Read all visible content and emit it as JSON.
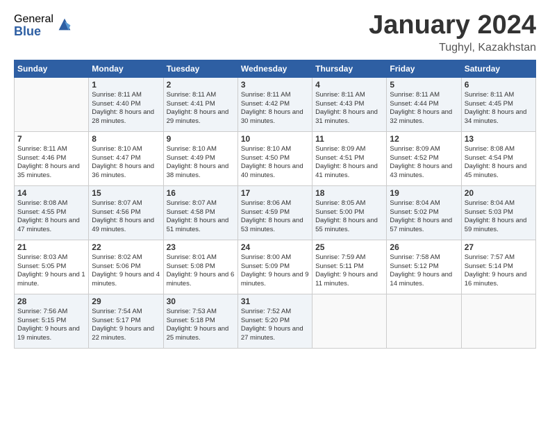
{
  "logo": {
    "general": "General",
    "blue": "Blue"
  },
  "title": "January 2024",
  "location": "Tughyl, Kazakhstan",
  "days_header": [
    "Sunday",
    "Monday",
    "Tuesday",
    "Wednesday",
    "Thursday",
    "Friday",
    "Saturday"
  ],
  "weeks": [
    [
      {
        "day": "",
        "sunrise": "",
        "sunset": "",
        "daylight": ""
      },
      {
        "day": "1",
        "sunrise": "8:11 AM",
        "sunset": "4:40 PM",
        "daylight": "8 hours and 28 minutes."
      },
      {
        "day": "2",
        "sunrise": "8:11 AM",
        "sunset": "4:41 PM",
        "daylight": "8 hours and 29 minutes."
      },
      {
        "day": "3",
        "sunrise": "8:11 AM",
        "sunset": "4:42 PM",
        "daylight": "8 hours and 30 minutes."
      },
      {
        "day": "4",
        "sunrise": "8:11 AM",
        "sunset": "4:43 PM",
        "daylight": "8 hours and 31 minutes."
      },
      {
        "day": "5",
        "sunrise": "8:11 AM",
        "sunset": "4:44 PM",
        "daylight": "8 hours and 32 minutes."
      },
      {
        "day": "6",
        "sunrise": "8:11 AM",
        "sunset": "4:45 PM",
        "daylight": "8 hours and 34 minutes."
      }
    ],
    [
      {
        "day": "7",
        "sunrise": "8:11 AM",
        "sunset": "4:46 PM",
        "daylight": "8 hours and 35 minutes."
      },
      {
        "day": "8",
        "sunrise": "8:10 AM",
        "sunset": "4:47 PM",
        "daylight": "8 hours and 36 minutes."
      },
      {
        "day": "9",
        "sunrise": "8:10 AM",
        "sunset": "4:49 PM",
        "daylight": "8 hours and 38 minutes."
      },
      {
        "day": "10",
        "sunrise": "8:10 AM",
        "sunset": "4:50 PM",
        "daylight": "8 hours and 40 minutes."
      },
      {
        "day": "11",
        "sunrise": "8:09 AM",
        "sunset": "4:51 PM",
        "daylight": "8 hours and 41 minutes."
      },
      {
        "day": "12",
        "sunrise": "8:09 AM",
        "sunset": "4:52 PM",
        "daylight": "8 hours and 43 minutes."
      },
      {
        "day": "13",
        "sunrise": "8:08 AM",
        "sunset": "4:54 PM",
        "daylight": "8 hours and 45 minutes."
      }
    ],
    [
      {
        "day": "14",
        "sunrise": "8:08 AM",
        "sunset": "4:55 PM",
        "daylight": "8 hours and 47 minutes."
      },
      {
        "day": "15",
        "sunrise": "8:07 AM",
        "sunset": "4:56 PM",
        "daylight": "8 hours and 49 minutes."
      },
      {
        "day": "16",
        "sunrise": "8:07 AM",
        "sunset": "4:58 PM",
        "daylight": "8 hours and 51 minutes."
      },
      {
        "day": "17",
        "sunrise": "8:06 AM",
        "sunset": "4:59 PM",
        "daylight": "8 hours and 53 minutes."
      },
      {
        "day": "18",
        "sunrise": "8:05 AM",
        "sunset": "5:00 PM",
        "daylight": "8 hours and 55 minutes."
      },
      {
        "day": "19",
        "sunrise": "8:04 AM",
        "sunset": "5:02 PM",
        "daylight": "8 hours and 57 minutes."
      },
      {
        "day": "20",
        "sunrise": "8:04 AM",
        "sunset": "5:03 PM",
        "daylight": "8 hours and 59 minutes."
      }
    ],
    [
      {
        "day": "21",
        "sunrise": "8:03 AM",
        "sunset": "5:05 PM",
        "daylight": "9 hours and 1 minute."
      },
      {
        "day": "22",
        "sunrise": "8:02 AM",
        "sunset": "5:06 PM",
        "daylight": "9 hours and 4 minutes."
      },
      {
        "day": "23",
        "sunrise": "8:01 AM",
        "sunset": "5:08 PM",
        "daylight": "9 hours and 6 minutes."
      },
      {
        "day": "24",
        "sunrise": "8:00 AM",
        "sunset": "5:09 PM",
        "daylight": "9 hours and 9 minutes."
      },
      {
        "day": "25",
        "sunrise": "7:59 AM",
        "sunset": "5:11 PM",
        "daylight": "9 hours and 11 minutes."
      },
      {
        "day": "26",
        "sunrise": "7:58 AM",
        "sunset": "5:12 PM",
        "daylight": "9 hours and 14 minutes."
      },
      {
        "day": "27",
        "sunrise": "7:57 AM",
        "sunset": "5:14 PM",
        "daylight": "9 hours and 16 minutes."
      }
    ],
    [
      {
        "day": "28",
        "sunrise": "7:56 AM",
        "sunset": "5:15 PM",
        "daylight": "9 hours and 19 minutes."
      },
      {
        "day": "29",
        "sunrise": "7:54 AM",
        "sunset": "5:17 PM",
        "daylight": "9 hours and 22 minutes."
      },
      {
        "day": "30",
        "sunrise": "7:53 AM",
        "sunset": "5:18 PM",
        "daylight": "9 hours and 25 minutes."
      },
      {
        "day": "31",
        "sunrise": "7:52 AM",
        "sunset": "5:20 PM",
        "daylight": "9 hours and 27 minutes."
      },
      {
        "day": "",
        "sunrise": "",
        "sunset": "",
        "daylight": ""
      },
      {
        "day": "",
        "sunrise": "",
        "sunset": "",
        "daylight": ""
      },
      {
        "day": "",
        "sunrise": "",
        "sunset": "",
        "daylight": ""
      }
    ]
  ]
}
